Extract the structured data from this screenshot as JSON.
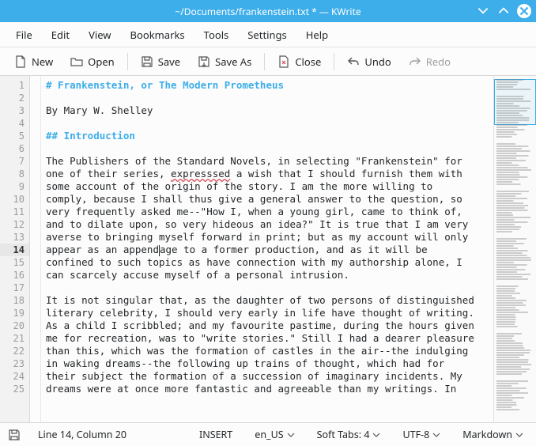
{
  "titlebar": {
    "title": "~/Documents/frankenstein.txt * — KWrite"
  },
  "menubar": {
    "items": [
      {
        "label": "File"
      },
      {
        "label": "Edit"
      },
      {
        "label": "View"
      },
      {
        "label": "Bookmarks"
      },
      {
        "label": "Tools"
      },
      {
        "label": "Settings"
      },
      {
        "label": "Help"
      }
    ]
  },
  "toolbar": {
    "new": "New",
    "open": "Open",
    "save": "Save",
    "saveas": "Save As",
    "close": "Close",
    "undo": "Undo",
    "redo": "Redo"
  },
  "editor": {
    "lines": [
      {
        "n": 1,
        "cls": "hdg",
        "text": "# Frankenstein, or The Modern Prometheus"
      },
      {
        "n": 2,
        "cls": "",
        "text": ""
      },
      {
        "n": 3,
        "cls": "",
        "text": "By Mary W. Shelley"
      },
      {
        "n": 4,
        "cls": "",
        "text": ""
      },
      {
        "n": 5,
        "cls": "hdg",
        "text": "## Introduction"
      },
      {
        "n": 6,
        "cls": "",
        "text": ""
      },
      {
        "n": 7,
        "cls": "",
        "text": "The Publishers of the Standard Novels, in selecting \"Frankenstein\" for"
      },
      {
        "n": 8,
        "cls": "spellrow",
        "pre": "one of their series, ",
        "spell": "expresssed",
        "post": " a wish that I should furnish them with"
      },
      {
        "n": 9,
        "cls": "",
        "text": "some account of the origin of the story. I am the more willing to"
      },
      {
        "n": 10,
        "cls": "",
        "text": "comply, because I shall thus give a general answer to the question, so"
      },
      {
        "n": 11,
        "cls": "",
        "text": "very frequently asked me--\"How I, when a young girl, came to think of,"
      },
      {
        "n": 12,
        "cls": "",
        "text": "and to dilate upon, so very hideous an idea?\" It is true that I am very"
      },
      {
        "n": 13,
        "cls": "",
        "text": "averse to bringing myself forward in print; but as my account will only"
      },
      {
        "n": 14,
        "cls": "cursor",
        "pre": "appear as an append",
        "post": "age to a former production, and as it will be"
      },
      {
        "n": 15,
        "cls": "",
        "text": "confined to such topics as have connection with my authorship alone, I"
      },
      {
        "n": 16,
        "cls": "",
        "text": "can scarcely accuse myself of a personal intrusion."
      },
      {
        "n": 17,
        "cls": "",
        "text": ""
      },
      {
        "n": 18,
        "cls": "",
        "text": "It is not singular that, as the daughter of two persons of distinguished"
      },
      {
        "n": 19,
        "cls": "",
        "text": "literary celebrity, I should very early in life have thought of writing."
      },
      {
        "n": 20,
        "cls": "",
        "text": "As a child I scribbled; and my favourite pastime, during the hours given"
      },
      {
        "n": 21,
        "cls": "",
        "text": "me for recreation, was to \"write stories.\" Still I had a dearer pleasure"
      },
      {
        "n": 22,
        "cls": "",
        "text": "than this, which was the formation of castles in the air--the indulging"
      },
      {
        "n": 23,
        "cls": "",
        "text": "in waking dreams--the following up trains of thought, which had for"
      },
      {
        "n": 24,
        "cls": "",
        "text": "their subject the formation of a succession of imaginary incidents. My"
      },
      {
        "n": 25,
        "cls": "",
        "text": "dreams were at once more fantastic and agreeable than my writings. In"
      }
    ],
    "current_line": 14
  },
  "statusbar": {
    "pos": "Line 14, Column 20",
    "mode": "INSERT",
    "lang": "en_US",
    "indent": "Soft Tabs: 4",
    "encoding": "UTF-8",
    "syntax": "Markdown"
  }
}
